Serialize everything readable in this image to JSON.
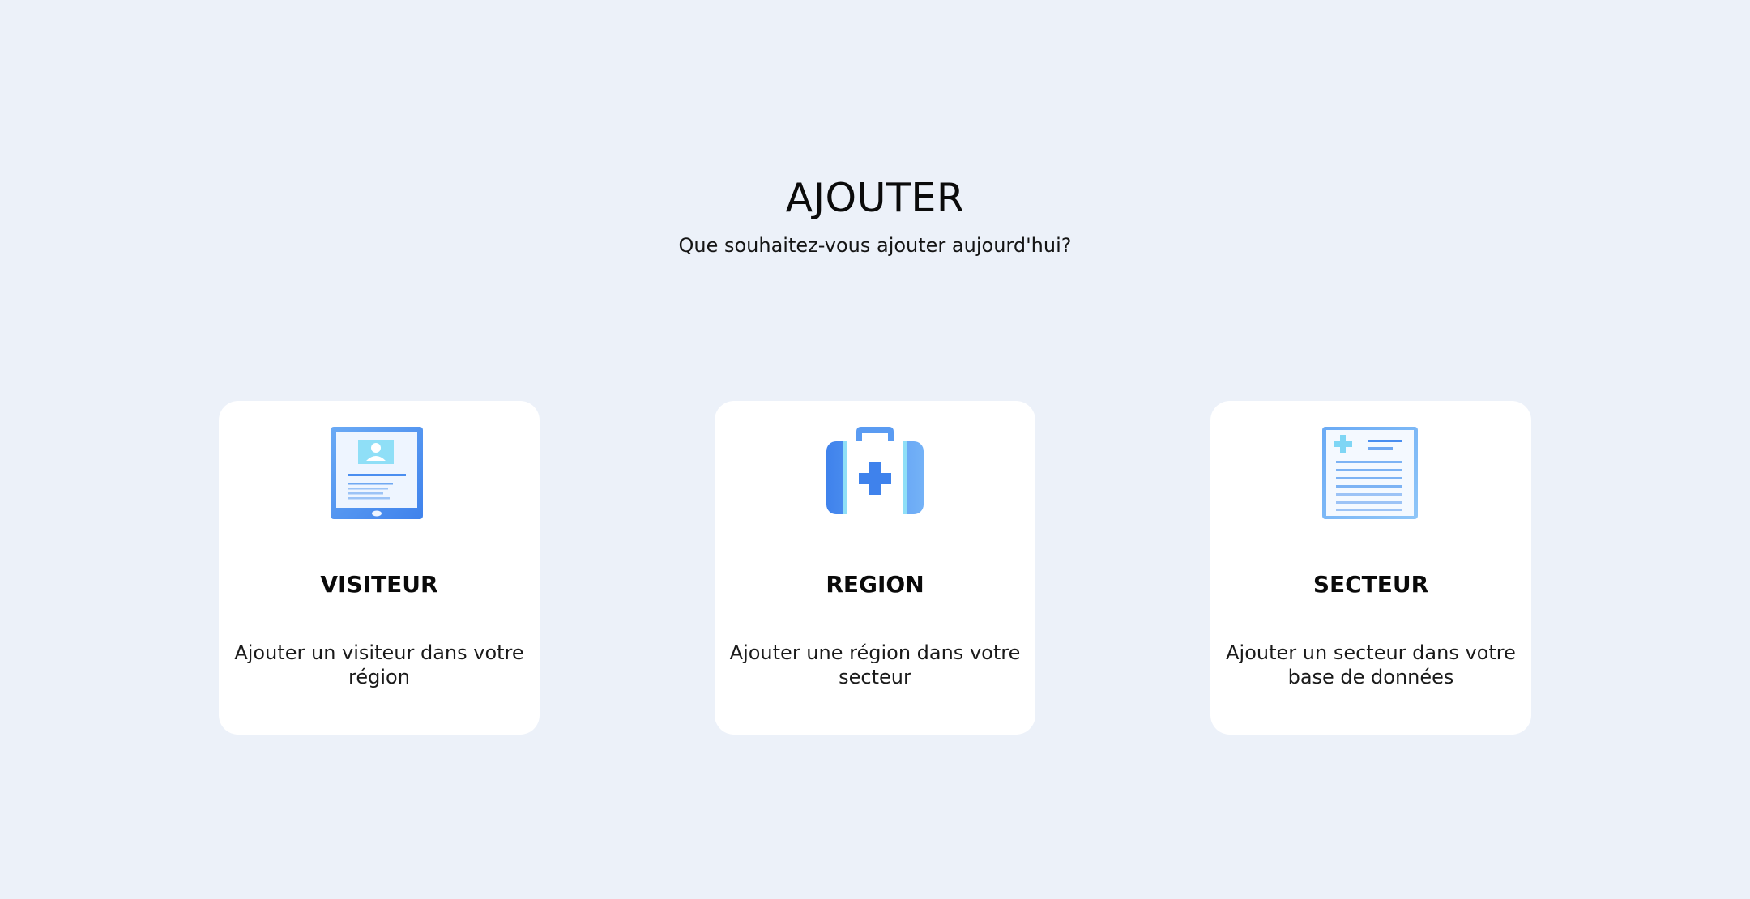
{
  "header": {
    "title": "AJOUTER",
    "subtitle": "Que souhaitez-vous ajouter aujourd'hui?"
  },
  "cards": [
    {
      "title": "VISITEUR",
      "description": "Ajouter un visiteur dans votre région",
      "icon": "tablet-profile-icon"
    },
    {
      "title": "REGION",
      "description": "Ajouter une région dans votre secteur",
      "icon": "medical-kit-icon"
    },
    {
      "title": "SECTEUR",
      "description": "Ajouter un secteur dans votre base de données",
      "icon": "medical-document-icon"
    }
  ],
  "colors": {
    "background": "#ecf1f9",
    "card": "#ffffff",
    "icon_blue": "#4a8ef0",
    "icon_light": "#7fd6f5"
  }
}
